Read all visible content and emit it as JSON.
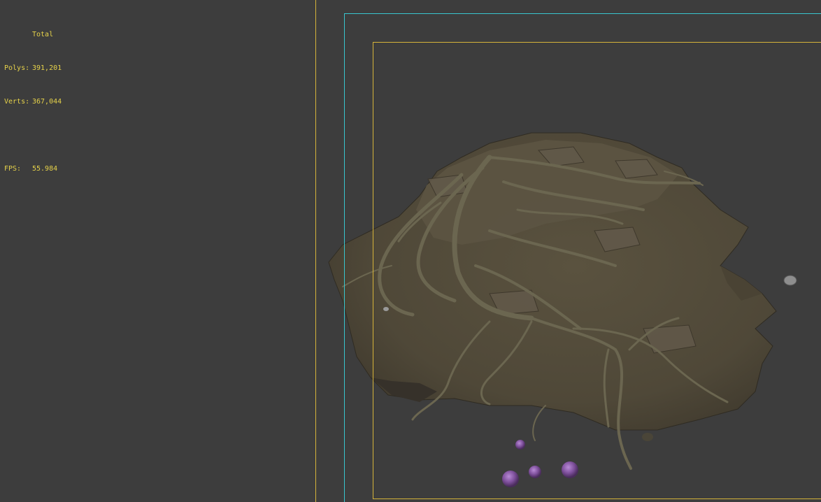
{
  "stats": {
    "header": "Total",
    "polys_label": "Polys:",
    "polys_value": "391,201",
    "verts_label": "Verts:",
    "verts_value": "367,044",
    "fps_label": "FPS:",
    "fps_value": "55.984"
  },
  "colors": {
    "viewport_bg": "#3d3d3d",
    "stats_text": "#e6d24a",
    "safe_frame": "#39c6cf",
    "action_frame": "#d6b43a",
    "terrain": "#5e5546",
    "roots": "#6f6a50",
    "spheres": "#8a5aa8"
  }
}
